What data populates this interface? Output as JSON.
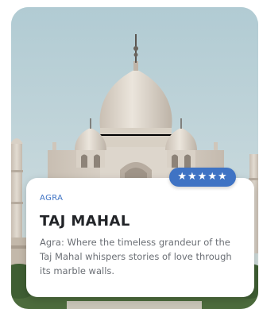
{
  "card": {
    "location": "AGRA",
    "title": "TAJ MAHAL",
    "description": "Agra: Where the timeless grandeur of the Taj Mahal whispers stories of love through its marble walls.",
    "rating_stars": 5,
    "rating_text": "★★★★★"
  },
  "colors": {
    "accent": "#3f73c4",
    "title": "#222428",
    "body_text": "#6b6f75",
    "sky": "#bcd2d8",
    "marble": "#ddd6cc"
  }
}
